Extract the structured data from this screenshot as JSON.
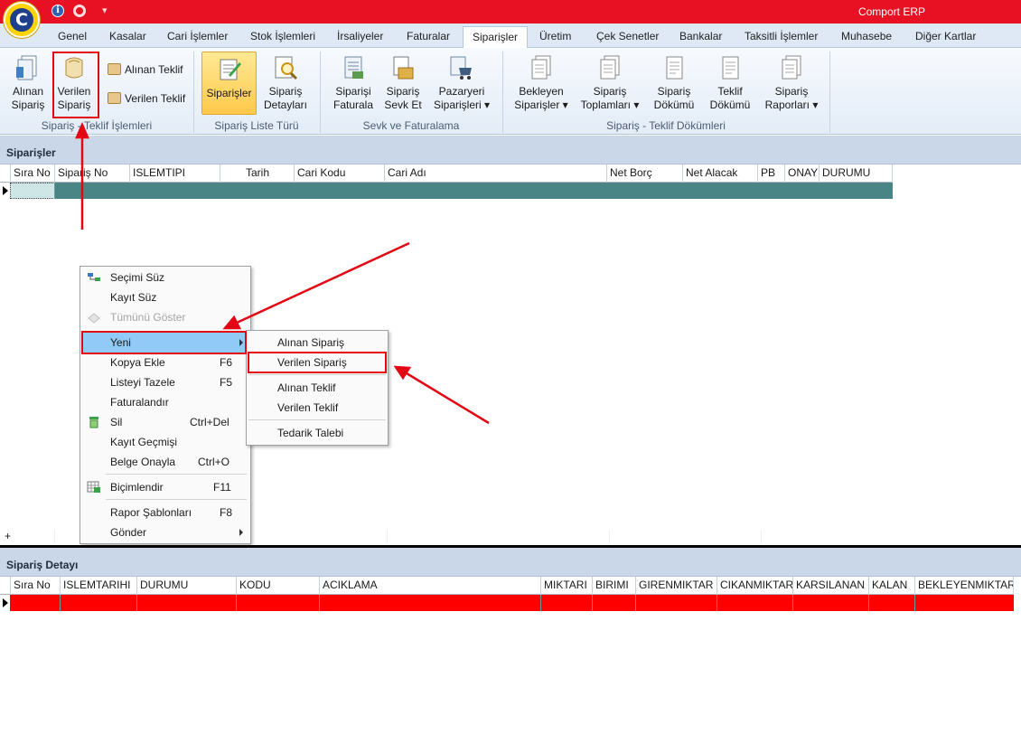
{
  "app": {
    "title": "Comport ERP",
    "logo_letter": "C"
  },
  "tabs": [
    {
      "label": "Genel",
      "active": false
    },
    {
      "label": "Kasalar",
      "active": false
    },
    {
      "label": "Cari İşlemler",
      "active": false
    },
    {
      "label": "Stok İşlemleri",
      "active": false
    },
    {
      "label": "İrsaliyeler",
      "active": false
    },
    {
      "label": "Faturalar",
      "active": false
    },
    {
      "label": "Siparişler",
      "active": true
    },
    {
      "label": "Üretim",
      "active": false
    },
    {
      "label": "Çek Senetler",
      "active": false
    },
    {
      "label": "Bankalar",
      "active": false
    },
    {
      "label": "Taksitli İşlemler",
      "active": false
    },
    {
      "label": "Muhasebe",
      "active": false
    },
    {
      "label": "Diğer Kartlar",
      "active": false
    }
  ],
  "ribbon": {
    "groups": [
      {
        "label": "Sipariş - Teklif İşlemleri"
      },
      {
        "label": "Sipariş Liste Türü"
      },
      {
        "label": "Sevk ve Faturalama"
      },
      {
        "label": "Sipariş - Teklif Dökümleri"
      }
    ],
    "buttons": {
      "alinan_siparis": {
        "l1": "Alınan",
        "l2": "Sipariş"
      },
      "verilen_siparis": {
        "l1": "Verilen",
        "l2": "Sipariş"
      },
      "alinan_teklif": "Alınan Teklif",
      "verilen_teklif": "Verilen Teklif",
      "siparisler": "Siparişler",
      "siparis_detaylari": {
        "l1": "Sipariş",
        "l2": "Detayları"
      },
      "siparisi_faturala": {
        "l1": "Siparişi",
        "l2": "Faturala"
      },
      "siparis_sevk_et": {
        "l1": "Sipariş",
        "l2": "Sevk Et"
      },
      "pazaryeri_siparisleri": {
        "l1": "Pazaryeri",
        "l2": "Siparişleri"
      },
      "bekleyen_siparisler": {
        "l1": "Bekleyen",
        "l2": "Siparişler"
      },
      "siparis_toplamlari": {
        "l1": "Sipariş",
        "l2": "Toplamları"
      },
      "siparis_dokumu": {
        "l1": "Sipariş",
        "l2": "Dökümü"
      },
      "teklif_dokumu": {
        "l1": "Teklif",
        "l2": "Dökümü"
      },
      "siparis_raporlari": {
        "l1": "Sipariş",
        "l2": "Raporları"
      }
    }
  },
  "orders_panel": {
    "title": "Siparişler",
    "columns": [
      "Sıra No",
      "Sipariş No",
      "ISLEMTIPI",
      "Tarih",
      "Cari Kodu",
      "Cari Adı",
      "Net Borç",
      "Net Alacak",
      "PB",
      "ONAY",
      "DURUMU"
    ],
    "add_glyph": "+"
  },
  "detail_panel": {
    "title": "Sipariş Detayı",
    "columns": [
      "Sıra No",
      "ISLEMTARIHI",
      "DURUMU",
      "KODU",
      "ACIKLAMA",
      "MIKTARI",
      "BIRIMI",
      "GIRENMIKTAR",
      "CIKANMIKTAR",
      "KARSILANAN",
      "KALAN",
      "BEKLEYENMIKTAR"
    ]
  },
  "context_menu": {
    "items": [
      {
        "label": "Seçimi Süz",
        "shortcut": "",
        "icon": "filter-selection-icon"
      },
      {
        "label": "Kayıt Süz",
        "shortcut": "",
        "icon": ""
      },
      {
        "label": "Tümünü Göster",
        "shortcut": "",
        "icon": "show-all-icon",
        "disabled": true
      },
      {
        "label": "Yeni",
        "shortcut": "",
        "icon": "",
        "submenu": true
      },
      {
        "label": "Kopya Ekle",
        "shortcut": "F6",
        "icon": ""
      },
      {
        "label": "Listeyi Tazele",
        "shortcut": "F5",
        "icon": ""
      },
      {
        "label": "Faturalandır",
        "shortcut": "",
        "icon": ""
      },
      {
        "label": "Sil",
        "shortcut": "Ctrl+Del",
        "icon": "delete-icon"
      },
      {
        "label": "Kayıt Geçmişi",
        "shortcut": "",
        "icon": ""
      },
      {
        "label": "Belge Onayla",
        "shortcut": "Ctrl+O",
        "icon": ""
      },
      {
        "label": "Biçimlendir",
        "shortcut": "F11",
        "icon": "format-grid-icon"
      },
      {
        "label": "Rapor Şablonları",
        "shortcut": "F8",
        "icon": ""
      },
      {
        "label": "Gönder",
        "shortcut": "",
        "icon": "",
        "submenu": true
      }
    ]
  },
  "submenu": {
    "items": [
      "Alınan Sipariş",
      "Verilen Sipariş",
      "Alınan Teklif",
      "Verilen Teklif",
      "Tedarik Talebi"
    ]
  },
  "colors": {
    "titlebar": "#e81123",
    "orders_row": "#4a8585",
    "detail_row": "#ff0000",
    "annotation": "#e30613",
    "menu_hover": "#91c9f7"
  }
}
